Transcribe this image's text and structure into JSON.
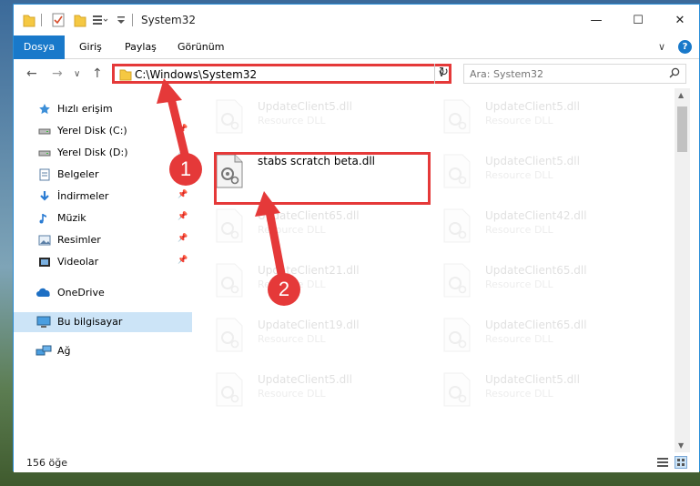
{
  "window": {
    "title": "System32",
    "minimize": "—",
    "maximize": "☐",
    "close": "✕"
  },
  "ribbon": {
    "tabs": [
      "Dosya",
      "Giriş",
      "Paylaş",
      "Görünüm"
    ],
    "expand": "∨",
    "help": "?"
  },
  "address": {
    "path": "C:\\Windows\\System32",
    "dropdown": "∨",
    "refresh": "↻"
  },
  "search": {
    "placeholder": "Ara: System32"
  },
  "nav": {
    "back": "←",
    "forward": "→",
    "recent": "∨",
    "up": "↑",
    "items": [
      {
        "label": "Hızlı erişim",
        "icon": "star-icon"
      },
      {
        "label": "Yerel Disk (C:)",
        "icon": "drive-icon"
      },
      {
        "label": "Yerel Disk (D:)",
        "icon": "drive-icon"
      },
      {
        "label": "Belgeler",
        "icon": "documents-icon"
      },
      {
        "label": "İndirmeler",
        "icon": "download-icon"
      },
      {
        "label": "Müzik",
        "icon": "music-icon"
      },
      {
        "label": "Resimler",
        "icon": "pictures-icon"
      },
      {
        "label": "Videolar",
        "icon": "video-icon"
      },
      {
        "label": "OneDrive",
        "icon": "cloud-icon"
      },
      {
        "label": "Bu bilgisayar",
        "icon": "computer-icon"
      },
      {
        "label": "Ağ",
        "icon": "network-icon"
      }
    ],
    "pin": "📌"
  },
  "files": {
    "left": [
      {
        "name": "UpdateClient5.dll",
        "type": "Resource DLL"
      },
      {
        "name": "stabs scratch beta.dll",
        "type": ""
      },
      {
        "name": "UpdateClient65.dll",
        "type": "Resource DLL"
      },
      {
        "name": "UpdateClient21.dll",
        "type": "Resource DLL"
      },
      {
        "name": "UpdateClient19.dll",
        "type": "Resource DLL"
      },
      {
        "name": "UpdateClient5.dll",
        "type": "Resource DLL"
      }
    ],
    "right": [
      {
        "name": "UpdateClient5.dll",
        "type": "Resource DLL"
      },
      {
        "name": "UpdateClient5.dll",
        "type": "Resource DLL"
      },
      {
        "name": "UpdateClient42.dll",
        "type": "Resource DLL"
      },
      {
        "name": "UpdateClient65.dll",
        "type": "Resource DLL"
      },
      {
        "name": "UpdateClient65.dll",
        "type": "Resource DLL"
      },
      {
        "name": "UpdateClient5.dll",
        "type": "Resource DLL"
      }
    ]
  },
  "status": {
    "count": "156 öğe"
  },
  "annotations": {
    "step1": "1",
    "step2": "2",
    "color": "#e53939"
  }
}
